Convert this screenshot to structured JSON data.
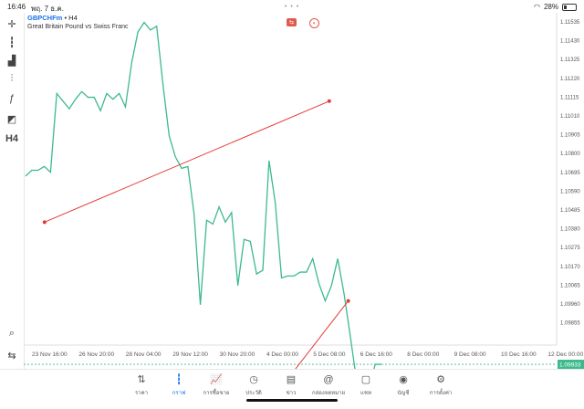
{
  "status": {
    "time": "16:46",
    "date": "พฤ. 7 ธ.ค.",
    "battery": "28%"
  },
  "symbol": {
    "ticker": "GBPCHFm",
    "timeframe": "H4",
    "description": "Great Britain Pound vs Swiss Franc"
  },
  "toolbar": [
    {
      "name": "crosshair-icon",
      "glyph": "✛"
    },
    {
      "name": "candlestick-icon",
      "glyph": "┇"
    },
    {
      "name": "volume-bars-icon",
      "glyph": "▟"
    },
    {
      "name": "indicators-icon",
      "glyph": "⫶"
    },
    {
      "name": "function-icon",
      "glyph": "ƒ"
    },
    {
      "name": "shapes-icon",
      "glyph": "◩"
    },
    {
      "name": "timeframe-label",
      "glyph": "H4"
    }
  ],
  "price_axis": [
    "1.11535",
    "1.11430",
    "1.11325",
    "1.11220",
    "1.11115",
    "1.11010",
    "1.10905",
    "1.10800",
    "1.10695",
    "1.10590",
    "1.10485",
    "1.10380",
    "1.10275",
    "1.10170",
    "1.10065",
    "1.09960",
    "1.09855"
  ],
  "current_price": "1.09933",
  "time_axis": [
    "23 Nov 16:00",
    "26 Nov 20:00",
    "28 Nov 04:00",
    "29 Nov 12:00",
    "30 Nov 20:00",
    "4 Dec 00:00",
    "5 Dec 08:00",
    "6 Dec 16:00",
    "8 Dec 00:00",
    "9 Dec 08:00",
    "10 Dec 16:00",
    "12 Dec 00:00"
  ],
  "chart_data": {
    "type": "line",
    "series": [
      {
        "values": [
          1.1073,
          1.1076,
          1.1076,
          1.1078,
          1.1075,
          1.1116,
          1.1112,
          1.1108,
          1.1113,
          1.1117,
          1.1114,
          1.1114,
          1.1107,
          1.1116,
          1.1113,
          1.1116,
          1.1109,
          1.1132,
          1.1148,
          1.1153,
          1.1149,
          1.1151,
          1.1121,
          1.1094,
          1.1083,
          1.1077,
          1.1078,
          1.1053,
          1.1006,
          1.105,
          1.1048,
          1.1057,
          1.1049,
          1.1054,
          1.1016,
          1.104,
          1.1039,
          1.1022,
          1.1024,
          1.1081,
          1.1059,
          1.102,
          1.1021,
          1.1021,
          1.1023,
          1.1023,
          1.103,
          1.1017,
          1.1008,
          1.1016,
          1.103,
          1.1012,
          1.099,
          1.0967,
          1.0958,
          1.0962,
          1.0975,
          1.0975
        ]
      }
    ],
    "trendlines": [
      {
        "color": "#e53935",
        "from": {
          "date": "2023-11-24",
          "price": 1.1049
        },
        "to": {
          "date": "2023-12-09",
          "price": 1.1112
        }
      },
      {
        "color": "#e53935",
        "from": {
          "date": "2023-12-06",
          "price": 1.0957
        },
        "to": {
          "date": "2023-12-10",
          "price": 1.1008
        }
      }
    ],
    "ylim": [
      1.0985,
      1.1158
    ],
    "line_color": "#3cba8c",
    "current_price_line_color": "#3cba8c"
  },
  "nav": [
    {
      "label": "ราคา",
      "glyph": "⇅",
      "active": false
    },
    {
      "label": "กราฟ",
      "glyph": "┇",
      "active": true
    },
    {
      "label": "การซื้อขาย",
      "glyph": "📈",
      "active": false
    },
    {
      "label": "ประวัติ",
      "glyph": "◷",
      "active": false
    },
    {
      "label": "ข่าว",
      "glyph": "▤",
      "active": false
    },
    {
      "label": "กล่องจดหมาย",
      "glyph": "@",
      "active": false
    },
    {
      "label": "แชท",
      "glyph": "▢",
      "active": false
    },
    {
      "label": "บัญชี",
      "glyph": "◉",
      "active": false
    },
    {
      "label": "การตั้งค่า",
      "glyph": "⚙",
      "active": false
    }
  ]
}
